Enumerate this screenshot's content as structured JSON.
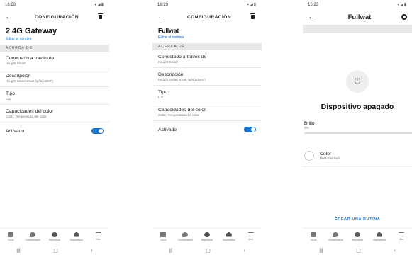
{
  "screens": [
    {
      "time": "16:23",
      "title": "CONFIGURACIÓN",
      "device_name": "2.4G Gateway",
      "edit_label": "Editar el nombre",
      "section": "ACERCA DE",
      "rows": [
        {
          "h": "Conectado a través de",
          "s": "HiLight Smart"
        },
        {
          "h": "Descripción",
          "s": "HiLight Smart smart light(LIGHT)"
        },
        {
          "h": "Tipo",
          "s": "Luz"
        },
        {
          "h": "Capacidades del color",
          "s": "Color, Temperatura del color"
        }
      ],
      "toggle_label": "Activado"
    },
    {
      "time": "16:23",
      "title": "CONFIGURACIÓN",
      "device_name": "Fullwat",
      "edit_label": "Editar el nombre",
      "section": "ACERCA DE",
      "rows": [
        {
          "h": "Conectado a través de",
          "s": "HiLight Smart"
        },
        {
          "h": "Descripción",
          "s": "HiLight Smart smart light(LIGHT)"
        },
        {
          "h": "Tipo",
          "s": "Luz"
        },
        {
          "h": "Capacidades del color",
          "s": "Color, Temperatura del color"
        }
      ],
      "toggle_label": "Activado"
    },
    {
      "time": "16:23",
      "title": "Fullwat",
      "status": "Dispositivo apagado",
      "brightness_label": "Brillo",
      "brightness_value": "0%",
      "color_label": "Color",
      "color_value": "Personalizado",
      "routine": "CREAR UNA RUTINA"
    }
  ],
  "nav": [
    "Inicio",
    "Comunicación",
    "Reproducir",
    "Dispositivos",
    "Más"
  ],
  "icons": {
    "back": "arrow-left",
    "delete": "trash",
    "settings": "gear",
    "power": "power"
  },
  "accent": "#1a73c8"
}
